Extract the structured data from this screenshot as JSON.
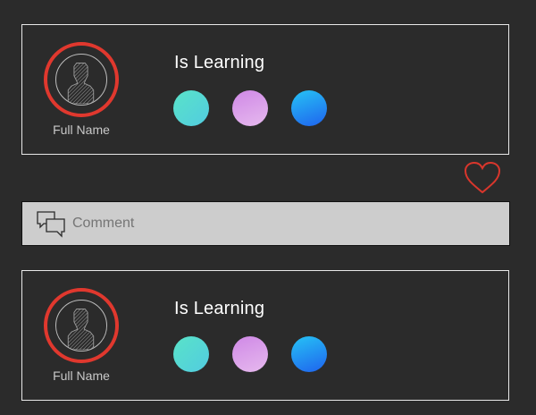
{
  "posts": [
    {
      "full_name": "Full Name",
      "title": "Is Learning",
      "avatar_icon": "person-silhouette-icon",
      "ring_color": "#e0382e",
      "topic_colors": [
        "#59e3c8",
        "#cf88e6",
        "#1f63ee"
      ]
    },
    {
      "full_name": "Full Name",
      "title": "Is Learning",
      "avatar_icon": "person-silhouette-icon",
      "ring_color": "#e0382e",
      "topic_colors": [
        "#59e3c8",
        "#cf88e6",
        "#1f63ee"
      ]
    }
  ],
  "actions": {
    "like_icon": "heart-outline-icon",
    "like_color": "#d9362c"
  },
  "comment": {
    "icon": "speech-bubbles-icon",
    "placeholder": "Comment"
  },
  "theme": {
    "background": "#2b2b2b",
    "card_border": "#e8e8e8",
    "comment_bar": "#cdcdcd"
  }
}
